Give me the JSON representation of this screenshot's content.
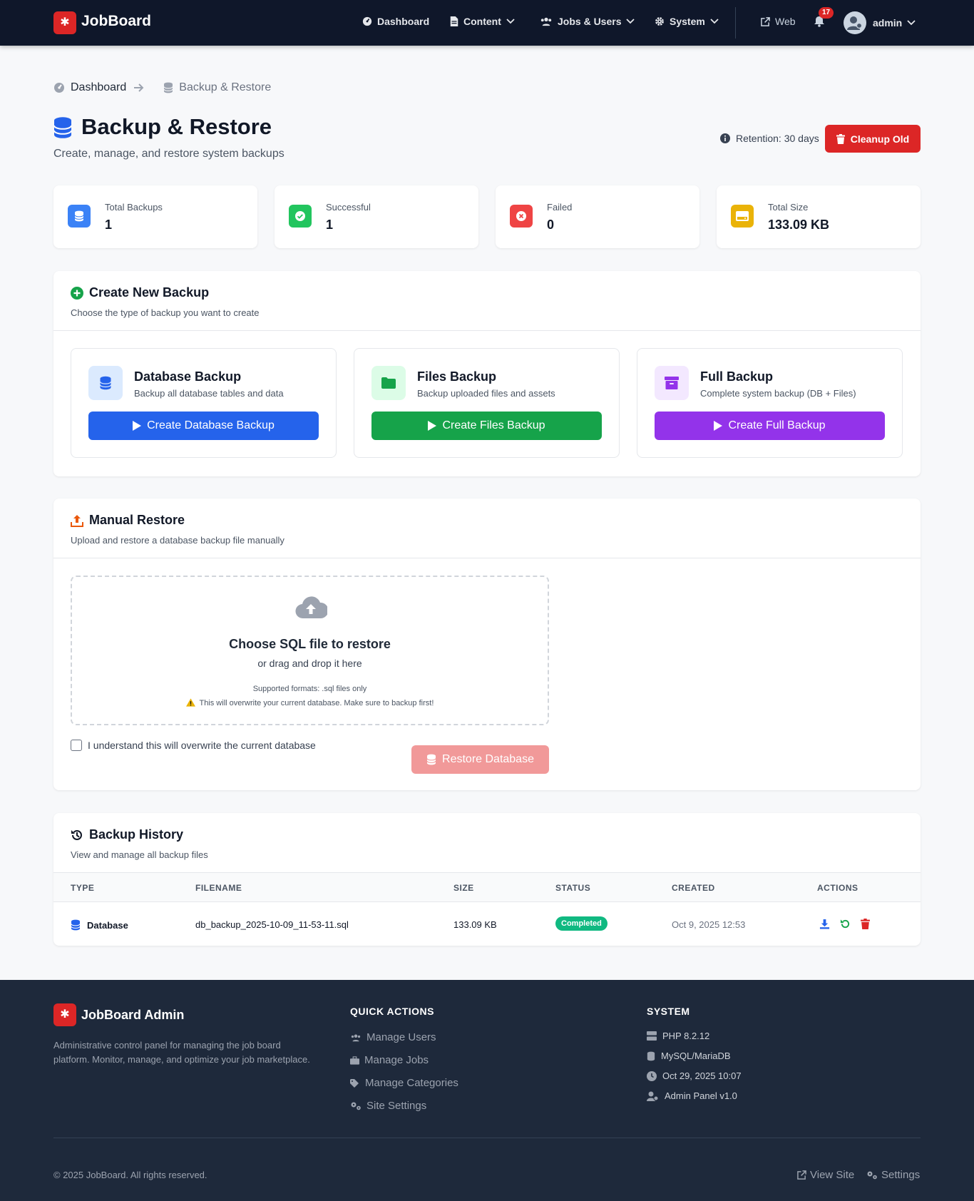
{
  "nav": {
    "brand": "JobBoard",
    "items": [
      {
        "label": "Dashboard",
        "icon": "dashboard-icon"
      },
      {
        "label": "Content",
        "icon": "file-icon"
      },
      {
        "label": "Jobs & Users",
        "icon": "users-icon"
      },
      {
        "label": "System",
        "icon": "gear-icon"
      }
    ],
    "web_label": "Web",
    "notification_count": "17",
    "user": "admin"
  },
  "breadcrumb": {
    "home": "Dashboard",
    "current": "Backup & Restore"
  },
  "page": {
    "title": "Backup & Restore",
    "subtitle": "Create, manage, and restore system backups",
    "retention": "Retention: 30 days",
    "cleanup_label": "Cleanup Old"
  },
  "stats": [
    {
      "label": "Total Backups",
      "value": "1",
      "color": "#3b82f6"
    },
    {
      "label": "Successful",
      "value": "1",
      "color": "#22c55e"
    },
    {
      "label": "Failed",
      "value": "0",
      "color": "#ef4444"
    },
    {
      "label": "Total Size",
      "value": "133.09 KB",
      "color": "#eab308"
    }
  ],
  "create": {
    "title": "Create New Backup",
    "subtitle": "Choose the type of backup you want to create",
    "types": [
      {
        "title": "Database Backup",
        "desc": "Backup all database tables and data",
        "button": "Create Database Backup",
        "color": "#2563eb"
      },
      {
        "title": "Files Backup",
        "desc": "Backup uploaded files and assets",
        "button": "Create Files Backup",
        "color": "#16a34a"
      },
      {
        "title": "Full Backup",
        "desc": "Complete system backup (DB + Files)",
        "button": "Create Full Backup",
        "color": "#9333ea"
      }
    ]
  },
  "restore": {
    "title": "Manual Restore",
    "subtitle": "Upload and restore a database backup file manually",
    "drop_title": "Choose SQL file to restore",
    "drop_sub": "or drag and drop it here",
    "formats": "Supported formats: .sql files only",
    "warning": "This will overwrite your current database. Make sure to backup first!",
    "confirm_label": "I understand this will overwrite the current database",
    "button": "Restore Database"
  },
  "history": {
    "title": "Backup History",
    "subtitle": "View and manage all backup files",
    "columns": [
      "TYPE",
      "FILENAME",
      "SIZE",
      "STATUS",
      "CREATED",
      "ACTIONS"
    ],
    "rows": [
      {
        "type": "Database",
        "filename": "db_backup_2025-10-09_11-53-11.sql",
        "size": "133.09 KB",
        "status": "Completed",
        "created": "Oct 9, 2025 12:53"
      }
    ]
  },
  "footer": {
    "brand": "JobBoard Admin",
    "description": "Administrative control panel for managing the job board platform. Monitor, manage, and optimize your job marketplace.",
    "quick_title": "QUICK ACTIONS",
    "quick_links": [
      "Manage Users",
      "Manage Jobs",
      "Manage Categories",
      "Site Settings"
    ],
    "system_title": "SYSTEM",
    "system_items": [
      "PHP 8.2.12",
      "MySQL/MariaDB",
      "Oct 29, 2025 10:07",
      "Admin Panel v1.0"
    ],
    "copyright": "© 2025 JobBoard. All rights reserved.",
    "view_site": "View Site",
    "settings": "Settings"
  }
}
